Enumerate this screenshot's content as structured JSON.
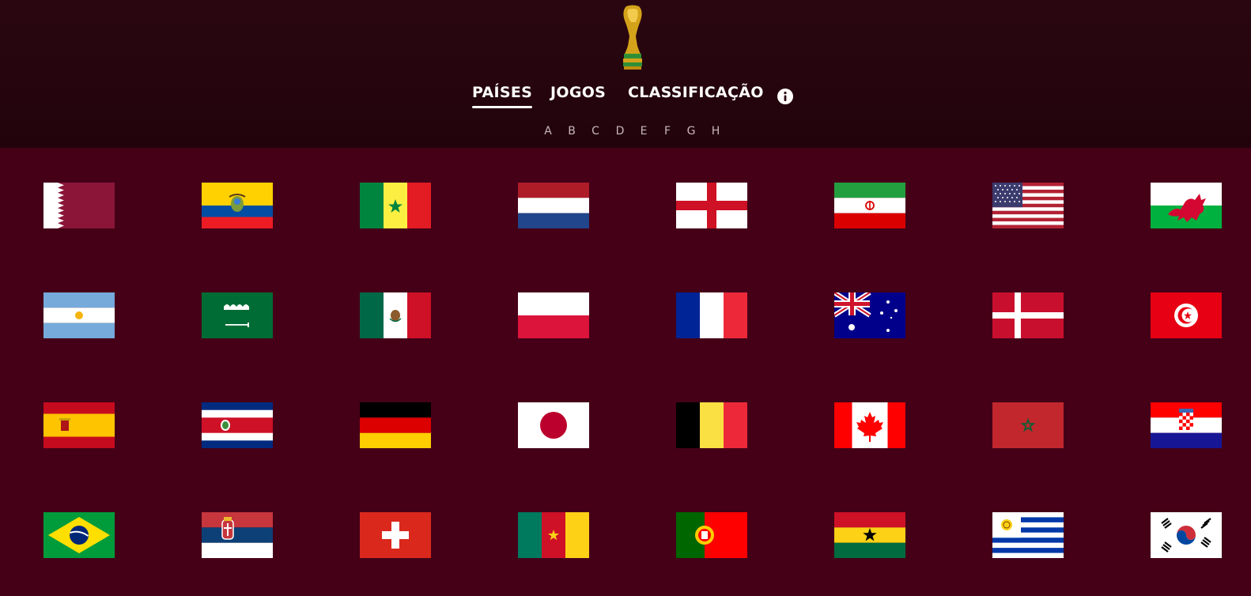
{
  "nav": {
    "items": [
      {
        "label": "PAÍSES",
        "active": true
      },
      {
        "label": "JOGOS",
        "active": false
      },
      {
        "label": "CLASSIFICAÇÃO",
        "active": false
      }
    ],
    "info_icon": "info-icon"
  },
  "groups": [
    "A",
    "B",
    "C",
    "D",
    "E",
    "F",
    "G",
    "H"
  ],
  "flags": [
    [
      "qatar",
      "ecuador",
      "senegal",
      "netherlands",
      "england",
      "iran",
      "usa",
      "wales"
    ],
    [
      "argentina",
      "saudi-arabia",
      "mexico",
      "poland",
      "france",
      "australia",
      "denmark",
      "tunisia"
    ],
    [
      "spain",
      "costa-rica",
      "germany",
      "japan",
      "belgium",
      "canada",
      "morocco",
      "croatia"
    ],
    [
      "brazil",
      "serbia",
      "switzerland",
      "cameroon",
      "portugal",
      "ghana",
      "uruguay",
      "south-korea"
    ]
  ],
  "colors": {
    "background": "#450018",
    "header": "#25040d",
    "active_underline": "#ffffff"
  }
}
